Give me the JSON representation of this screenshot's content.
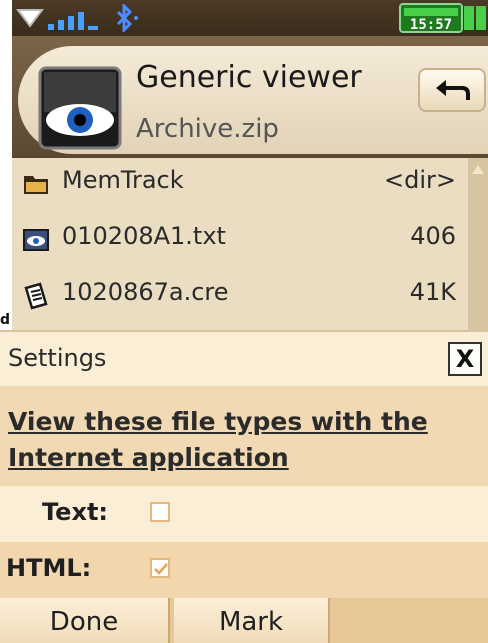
{
  "app": {
    "title": "Generic viewer",
    "subtitle": "Archive.zip",
    "icon": "eye-icon",
    "back_icon": "back-arrow-icon"
  },
  "status_bar": {
    "time": "15:57",
    "icons": [
      "signal-icon",
      "bluetooth-icon",
      "battery-icon"
    ]
  },
  "file_list": {
    "items": [
      {
        "icon": "folder-icon",
        "name": "MemTrack",
        "size": "<dir>"
      },
      {
        "icon": "image-file-icon",
        "name": "010208A1.txt",
        "size": "406"
      },
      {
        "icon": "script-file-icon",
        "name": "1020867a.cre",
        "size": "41K"
      }
    ]
  },
  "edge_marks": [
    "d"
  ],
  "dialog": {
    "title": "Settings",
    "close_label": "X",
    "link_text": "View these file types with the Internet application",
    "options": [
      {
        "label": "Text:",
        "checked": false
      },
      {
        "label": "HTML:",
        "checked": true
      }
    ]
  },
  "softkeys": {
    "left": "Done",
    "middle": "Mark"
  },
  "colors": {
    "accent": "#e3b780",
    "dialog_bg": "#fbeed6",
    "header_bg": "#6b5538"
  }
}
